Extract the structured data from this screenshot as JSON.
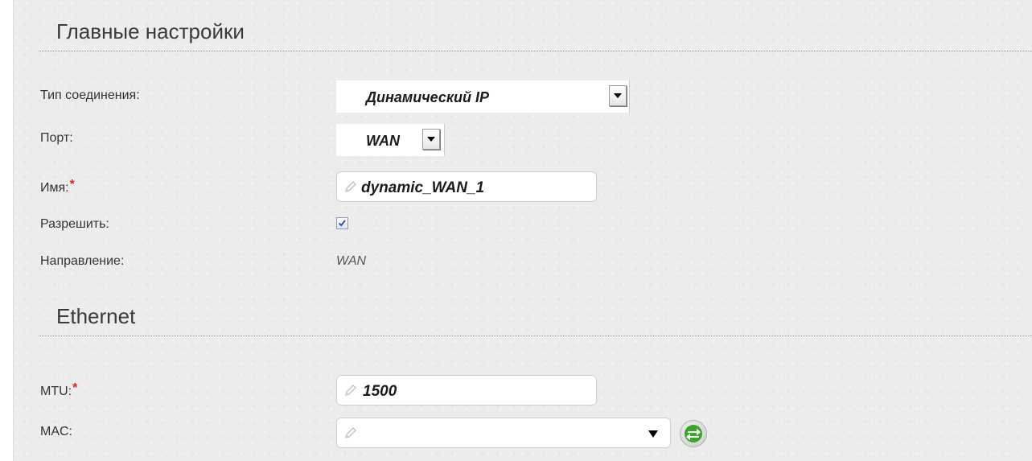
{
  "sections": {
    "main_title": "Главные настройки",
    "ethernet_title": "Ethernet"
  },
  "fields": {
    "connection_type": {
      "label": "Тип соединения:",
      "value": "Динамический IP"
    },
    "port": {
      "label": "Порт:",
      "value": "WAN"
    },
    "name": {
      "label": "Имя:",
      "required_mark": "*",
      "value": "dynamic_WAN_1"
    },
    "enable": {
      "label": "Разрешить:",
      "checked": true
    },
    "direction": {
      "label": "Направление:",
      "value": "WAN"
    },
    "mtu": {
      "label": "MTU:",
      "required_mark": "*",
      "value": "1500"
    },
    "mac": {
      "label": "MAC:",
      "value": ""
    }
  },
  "icons": {
    "pencil": "pencil-icon",
    "dropdown": "chevron-down-icon",
    "refresh": "swap-arrows-icon",
    "checkmark": "checkmark-icon"
  },
  "colors": {
    "required": "#e02020",
    "refresh_green": "#3aa52a",
    "checkbox_check": "#1f4fa8"
  }
}
